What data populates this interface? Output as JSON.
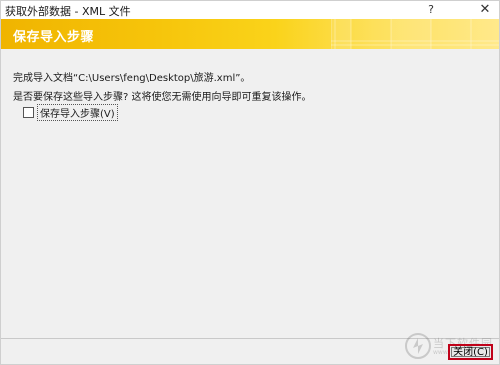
{
  "window": {
    "title": "获取外部数据 - XML 文件",
    "help_label": "?",
    "close_label": "✕"
  },
  "banner": {
    "title": "保存导入步骤"
  },
  "content": {
    "message_complete": "完成导入文档“C:\\Users\\feng\\Desktop\\旅游.xml”。",
    "message_question": "是否要保存这些导入步骤? 这将使您无需使用向导即可重复该操作。",
    "save_steps_checkbox": {
      "label": "保存导入步骤(V)",
      "checked": false
    }
  },
  "footer": {
    "close_button_label": "关闭(C)"
  },
  "watermark": {
    "text": "当下软件园",
    "subtext": "www.downxia.com"
  },
  "colors": {
    "banner_start": "#f0b400",
    "banner_end": "#ffe98b",
    "highlight_border": "#c0021a"
  }
}
